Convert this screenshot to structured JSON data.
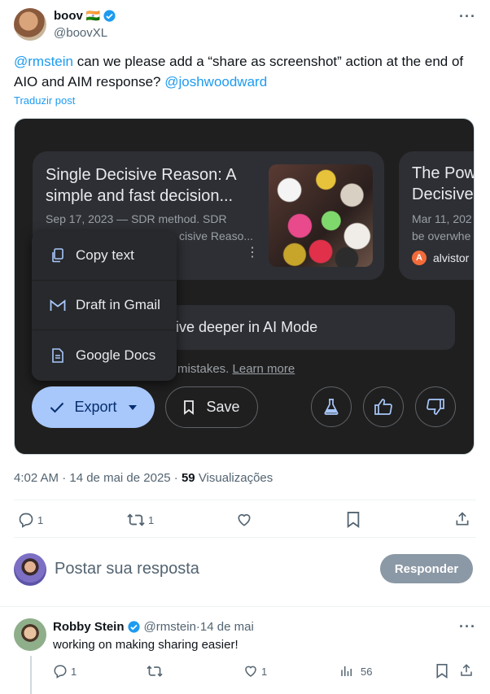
{
  "tweet": {
    "display_name": "boov",
    "flag": "🇮🇳",
    "handle": "@boovXL",
    "mention1": "@rmstein",
    "text_part1": " can we please add a “share as screenshot” action at the end of AIO and AIM response? ",
    "mention2": "@joshwoodward",
    "translate": "Traduzir post",
    "timestamp": "4:02 AM · 14 de mai de 2025 · ",
    "views_count": "59",
    "views_label": " Visualizações",
    "replies": "1",
    "reposts": "1",
    "likes": "",
    "more": "···"
  },
  "screenshot": {
    "card1": {
      "title": "Single Decisive Reason: A simple and fast decision...",
      "date_line": "Sep 17, 2023 — SDR method. SDR",
      "snippet_tail": "cisive Reaso..."
    },
    "card2": {
      "title_line1": "The Pow",
      "title_line2": "Decisive",
      "date_line": "Mar 11, 202",
      "snippet": "be overwhe",
      "source": "alvistor"
    },
    "menu": {
      "copy_text": "Copy text",
      "draft_gmail": "Draft in Gmail",
      "google_docs": "Google Docs"
    },
    "dive_deeper": "ive deeper in AI Mode",
    "disclaimer": "mistakes. ",
    "learn_more": "Learn more",
    "export_label": "Export",
    "save_label": "Save"
  },
  "reply_box": {
    "placeholder": "Postar sua resposta",
    "button": "Responder"
  },
  "reply": {
    "display_name": "Robby Stein",
    "handle": "@rmstein",
    "sep": " · ",
    "date": "14 de mai",
    "text": "working on making sharing easier!",
    "replies": "1",
    "likes": "1",
    "views": "56",
    "more": "···"
  },
  "colors": {
    "link": "#1d9bf0",
    "export_bg": "#a8c7fa",
    "reply_button_bg": "#8b98a5"
  }
}
